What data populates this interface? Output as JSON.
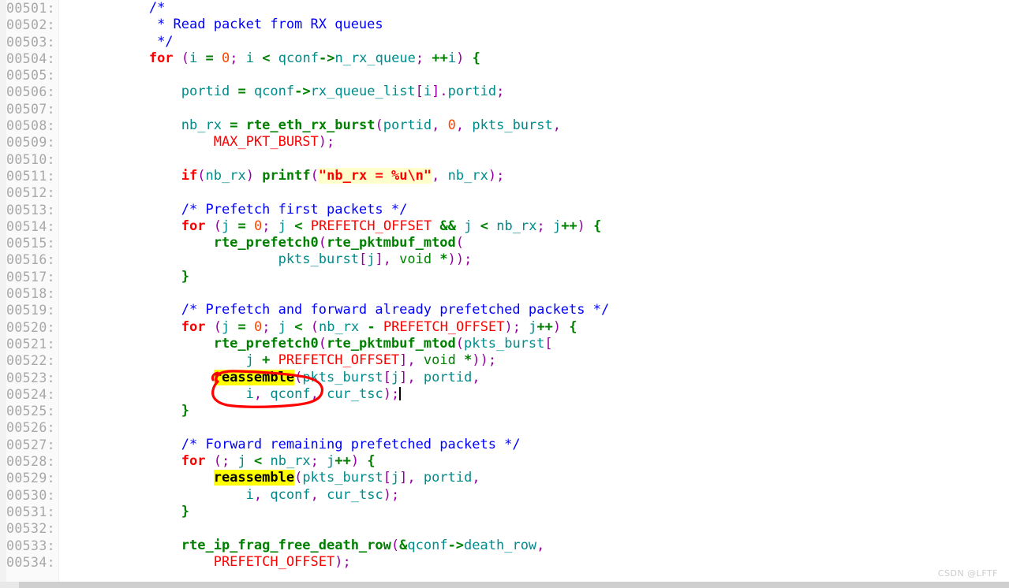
{
  "editor": {
    "language": "c",
    "highlight_term": "reassemble",
    "search_string_highlight": "\"nb_rx = %u\\n\"",
    "first_line_number": "00501",
    "last_line_number": "00534",
    "caret_line": "00524",
    "colors": {
      "background": "#ffffff",
      "gutter": "#fafafa",
      "line_number": "#a8a8a8",
      "comment": "#0000ff",
      "keyword": "#ff0000",
      "punctuation": "#9400a0",
      "identifier": "#008b8b",
      "function": "#008000",
      "macro": "#ff0000",
      "number": "#ff4500",
      "string": "#ff0000",
      "string_bg": "#ffffcc",
      "match_highlight_bg": "#ffff00",
      "annotation": "#ff0000",
      "scrollbar": "#cfcfcf"
    }
  },
  "lines": [
    {
      "no": "00501:",
      "tokens": [
        {
          "t": "plain",
          "v": "            "
        },
        {
          "t": "cm",
          "v": "/*"
        }
      ]
    },
    {
      "no": "00502:",
      "tokens": [
        {
          "t": "plain",
          "v": "             "
        },
        {
          "t": "cm",
          "v": "* Read packet from RX queues"
        }
      ]
    },
    {
      "no": "00503:",
      "tokens": [
        {
          "t": "plain",
          "v": "             "
        },
        {
          "t": "cm",
          "v": "*/"
        }
      ]
    },
    {
      "no": "00504:",
      "tokens": [
        {
          "t": "plain",
          "v": "            "
        },
        {
          "t": "kw",
          "v": "for"
        },
        {
          "t": "plain",
          "v": " "
        },
        {
          "t": "pn",
          "v": "("
        },
        {
          "t": "id",
          "v": "i"
        },
        {
          "t": "plain",
          "v": " "
        },
        {
          "t": "op",
          "v": "="
        },
        {
          "t": "plain",
          "v": " "
        },
        {
          "t": "num",
          "v": "0"
        },
        {
          "t": "pn",
          "v": ";"
        },
        {
          "t": "plain",
          "v": " "
        },
        {
          "t": "id",
          "v": "i"
        },
        {
          "t": "plain",
          "v": " "
        },
        {
          "t": "op",
          "v": "<"
        },
        {
          "t": "plain",
          "v": " "
        },
        {
          "t": "id",
          "v": "qconf"
        },
        {
          "t": "op",
          "v": "->"
        },
        {
          "t": "id",
          "v": "n_rx_queue"
        },
        {
          "t": "pn",
          "v": ";"
        },
        {
          "t": "plain",
          "v": " "
        },
        {
          "t": "op",
          "v": "++"
        },
        {
          "t": "id",
          "v": "i"
        },
        {
          "t": "pn",
          "v": ")"
        },
        {
          "t": "plain",
          "v": " "
        },
        {
          "t": "op",
          "v": "{"
        }
      ]
    },
    {
      "no": "00505:",
      "tokens": []
    },
    {
      "no": "00506:",
      "tokens": [
        {
          "t": "plain",
          "v": "                "
        },
        {
          "t": "id",
          "v": "portid"
        },
        {
          "t": "plain",
          "v": " "
        },
        {
          "t": "op",
          "v": "="
        },
        {
          "t": "plain",
          "v": " "
        },
        {
          "t": "id",
          "v": "qconf"
        },
        {
          "t": "op",
          "v": "->"
        },
        {
          "t": "id",
          "v": "rx_queue_list"
        },
        {
          "t": "pn",
          "v": "["
        },
        {
          "t": "id",
          "v": "i"
        },
        {
          "t": "pn",
          "v": "]"
        },
        {
          "t": "pn",
          "v": "."
        },
        {
          "t": "id",
          "v": "portid"
        },
        {
          "t": "pn",
          "v": ";"
        }
      ]
    },
    {
      "no": "00507:",
      "tokens": []
    },
    {
      "no": "00508:",
      "tokens": [
        {
          "t": "plain",
          "v": "                "
        },
        {
          "t": "id",
          "v": "nb_rx"
        },
        {
          "t": "plain",
          "v": " "
        },
        {
          "t": "op",
          "v": "="
        },
        {
          "t": "plain",
          "v": " "
        },
        {
          "t": "fn",
          "v": "rte_eth_rx_burst"
        },
        {
          "t": "pn",
          "v": "("
        },
        {
          "t": "id",
          "v": "portid"
        },
        {
          "t": "pn",
          "v": ","
        },
        {
          "t": "plain",
          "v": " "
        },
        {
          "t": "num",
          "v": "0"
        },
        {
          "t": "pn",
          "v": ","
        },
        {
          "t": "plain",
          "v": " "
        },
        {
          "t": "id",
          "v": "pkts_burst"
        },
        {
          "t": "pn",
          "v": ","
        }
      ]
    },
    {
      "no": "00509:",
      "tokens": [
        {
          "t": "plain",
          "v": "                    "
        },
        {
          "t": "mac",
          "v": "MAX_PKT_BURST"
        },
        {
          "t": "pn",
          "v": ");"
        }
      ]
    },
    {
      "no": "00510:",
      "tokens": []
    },
    {
      "no": "00511:",
      "tokens": [
        {
          "t": "plain",
          "v": "                "
        },
        {
          "t": "kw",
          "v": "if"
        },
        {
          "t": "pn",
          "v": "("
        },
        {
          "t": "id",
          "v": "nb_rx"
        },
        {
          "t": "pn",
          "v": ")"
        },
        {
          "t": "plain",
          "v": " "
        },
        {
          "t": "fn",
          "v": "printf"
        },
        {
          "t": "pn",
          "v": "("
        },
        {
          "t": "str",
          "v": "\"nb_rx = %u\\n\""
        },
        {
          "t": "pn",
          "v": ","
        },
        {
          "t": "plain",
          "v": " "
        },
        {
          "t": "id",
          "v": "nb_rx"
        },
        {
          "t": "pn",
          "v": ");"
        }
      ]
    },
    {
      "no": "00512:",
      "tokens": []
    },
    {
      "no": "00513:",
      "tokens": [
        {
          "t": "plain",
          "v": "                "
        },
        {
          "t": "cm",
          "v": "/* Prefetch first packets */"
        }
      ]
    },
    {
      "no": "00514:",
      "tokens": [
        {
          "t": "plain",
          "v": "                "
        },
        {
          "t": "kw",
          "v": "for"
        },
        {
          "t": "plain",
          "v": " "
        },
        {
          "t": "pn",
          "v": "("
        },
        {
          "t": "id",
          "v": "j"
        },
        {
          "t": "plain",
          "v": " "
        },
        {
          "t": "op",
          "v": "="
        },
        {
          "t": "plain",
          "v": " "
        },
        {
          "t": "num",
          "v": "0"
        },
        {
          "t": "pn",
          "v": ";"
        },
        {
          "t": "plain",
          "v": " "
        },
        {
          "t": "id",
          "v": "j"
        },
        {
          "t": "plain",
          "v": " "
        },
        {
          "t": "op",
          "v": "<"
        },
        {
          "t": "plain",
          "v": " "
        },
        {
          "t": "mac",
          "v": "PREFETCH_OFFSET"
        },
        {
          "t": "plain",
          "v": " "
        },
        {
          "t": "op",
          "v": "&&"
        },
        {
          "t": "plain",
          "v": " "
        },
        {
          "t": "id",
          "v": "j"
        },
        {
          "t": "plain",
          "v": " "
        },
        {
          "t": "op",
          "v": "<"
        },
        {
          "t": "plain",
          "v": " "
        },
        {
          "t": "id",
          "v": "nb_rx"
        },
        {
          "t": "pn",
          "v": ";"
        },
        {
          "t": "plain",
          "v": " "
        },
        {
          "t": "id",
          "v": "j"
        },
        {
          "t": "op",
          "v": "++"
        },
        {
          "t": "pn",
          "v": ")"
        },
        {
          "t": "plain",
          "v": " "
        },
        {
          "t": "op",
          "v": "{"
        }
      ]
    },
    {
      "no": "00515:",
      "tokens": [
        {
          "t": "plain",
          "v": "                    "
        },
        {
          "t": "fn",
          "v": "rte_prefetch0"
        },
        {
          "t": "pn",
          "v": "("
        },
        {
          "t": "fn",
          "v": "rte_pktmbuf_mtod"
        },
        {
          "t": "pn",
          "v": "("
        }
      ]
    },
    {
      "no": "00516:",
      "tokens": [
        {
          "t": "plain",
          "v": "                            "
        },
        {
          "t": "id",
          "v": "pkts_burst"
        },
        {
          "t": "pn",
          "v": "["
        },
        {
          "t": "id",
          "v": "j"
        },
        {
          "t": "pn",
          "v": "],"
        },
        {
          "t": "plain",
          "v": " "
        },
        {
          "t": "ty",
          "v": "void"
        },
        {
          "t": "plain",
          "v": " "
        },
        {
          "t": "op",
          "v": "*"
        },
        {
          "t": "pn",
          "v": "));"
        }
      ]
    },
    {
      "no": "00517:",
      "tokens": [
        {
          "t": "plain",
          "v": "                "
        },
        {
          "t": "op",
          "v": "}"
        }
      ]
    },
    {
      "no": "00518:",
      "tokens": []
    },
    {
      "no": "00519:",
      "tokens": [
        {
          "t": "plain",
          "v": "                "
        },
        {
          "t": "cm",
          "v": "/* Prefetch and forward already prefetched packets */"
        }
      ]
    },
    {
      "no": "00520:",
      "tokens": [
        {
          "t": "plain",
          "v": "                "
        },
        {
          "t": "kw",
          "v": "for"
        },
        {
          "t": "plain",
          "v": " "
        },
        {
          "t": "pn",
          "v": "("
        },
        {
          "t": "id",
          "v": "j"
        },
        {
          "t": "plain",
          "v": " "
        },
        {
          "t": "op",
          "v": "="
        },
        {
          "t": "plain",
          "v": " "
        },
        {
          "t": "num",
          "v": "0"
        },
        {
          "t": "pn",
          "v": ";"
        },
        {
          "t": "plain",
          "v": " "
        },
        {
          "t": "id",
          "v": "j"
        },
        {
          "t": "plain",
          "v": " "
        },
        {
          "t": "op",
          "v": "<"
        },
        {
          "t": "plain",
          "v": " "
        },
        {
          "t": "pn",
          "v": "("
        },
        {
          "t": "id",
          "v": "nb_rx"
        },
        {
          "t": "plain",
          "v": " "
        },
        {
          "t": "op",
          "v": "-"
        },
        {
          "t": "plain",
          "v": " "
        },
        {
          "t": "mac",
          "v": "PREFETCH_OFFSET"
        },
        {
          "t": "pn",
          "v": ");"
        },
        {
          "t": "plain",
          "v": " "
        },
        {
          "t": "id",
          "v": "j"
        },
        {
          "t": "op",
          "v": "++"
        },
        {
          "t": "pn",
          "v": ")"
        },
        {
          "t": "plain",
          "v": " "
        },
        {
          "t": "op",
          "v": "{"
        }
      ]
    },
    {
      "no": "00521:",
      "tokens": [
        {
          "t": "plain",
          "v": "                    "
        },
        {
          "t": "fn",
          "v": "rte_prefetch0"
        },
        {
          "t": "pn",
          "v": "("
        },
        {
          "t": "fn",
          "v": "rte_pktmbuf_mtod"
        },
        {
          "t": "pn",
          "v": "("
        },
        {
          "t": "id",
          "v": "pkts_burst"
        },
        {
          "t": "pn",
          "v": "["
        }
      ]
    },
    {
      "no": "00522:",
      "tokens": [
        {
          "t": "plain",
          "v": "                        "
        },
        {
          "t": "id",
          "v": "j"
        },
        {
          "t": "plain",
          "v": " "
        },
        {
          "t": "op",
          "v": "+"
        },
        {
          "t": "plain",
          "v": " "
        },
        {
          "t": "mac",
          "v": "PREFETCH_OFFSET"
        },
        {
          "t": "pn",
          "v": "],"
        },
        {
          "t": "plain",
          "v": " "
        },
        {
          "t": "ty",
          "v": "void"
        },
        {
          "t": "plain",
          "v": " "
        },
        {
          "t": "op",
          "v": "*"
        },
        {
          "t": "pn",
          "v": "));"
        }
      ]
    },
    {
      "no": "00523:",
      "tokens": [
        {
          "t": "plain",
          "v": "                    "
        },
        {
          "t": "hl",
          "v": "reassemble"
        },
        {
          "t": "pn",
          "v": "("
        },
        {
          "t": "id",
          "v": "pkts_burst"
        },
        {
          "t": "pn",
          "v": "["
        },
        {
          "t": "id",
          "v": "j"
        },
        {
          "t": "pn",
          "v": "],"
        },
        {
          "t": "plain",
          "v": " "
        },
        {
          "t": "id",
          "v": "portid"
        },
        {
          "t": "pn",
          "v": ","
        }
      ]
    },
    {
      "no": "00524:",
      "tokens": [
        {
          "t": "plain",
          "v": "                        "
        },
        {
          "t": "id",
          "v": "i"
        },
        {
          "t": "pn",
          "v": ","
        },
        {
          "t": "plain",
          "v": " "
        },
        {
          "t": "id",
          "v": "qconf"
        },
        {
          "t": "pn",
          "v": ","
        },
        {
          "t": "plain",
          "v": " "
        },
        {
          "t": "id",
          "v": "cur_tsc"
        },
        {
          "t": "pn",
          "v": ");"
        },
        {
          "t": "caret",
          "v": ""
        }
      ]
    },
    {
      "no": "00525:",
      "tokens": [
        {
          "t": "plain",
          "v": "                "
        },
        {
          "t": "op",
          "v": "}"
        }
      ]
    },
    {
      "no": "00526:",
      "tokens": []
    },
    {
      "no": "00527:",
      "tokens": [
        {
          "t": "plain",
          "v": "                "
        },
        {
          "t": "cm",
          "v": "/* Forward remaining prefetched packets */"
        }
      ]
    },
    {
      "no": "00528:",
      "tokens": [
        {
          "t": "plain",
          "v": "                "
        },
        {
          "t": "kw",
          "v": "for"
        },
        {
          "t": "plain",
          "v": " "
        },
        {
          "t": "pn",
          "v": "(;"
        },
        {
          "t": "plain",
          "v": " "
        },
        {
          "t": "id",
          "v": "j"
        },
        {
          "t": "plain",
          "v": " "
        },
        {
          "t": "op",
          "v": "<"
        },
        {
          "t": "plain",
          "v": " "
        },
        {
          "t": "id",
          "v": "nb_rx"
        },
        {
          "t": "pn",
          "v": ";"
        },
        {
          "t": "plain",
          "v": " "
        },
        {
          "t": "id",
          "v": "j"
        },
        {
          "t": "op",
          "v": "++"
        },
        {
          "t": "pn",
          "v": ")"
        },
        {
          "t": "plain",
          "v": " "
        },
        {
          "t": "op",
          "v": "{"
        }
      ]
    },
    {
      "no": "00529:",
      "tokens": [
        {
          "t": "plain",
          "v": "                    "
        },
        {
          "t": "hl",
          "v": "reassemble"
        },
        {
          "t": "pn",
          "v": "("
        },
        {
          "t": "id",
          "v": "pkts_burst"
        },
        {
          "t": "pn",
          "v": "["
        },
        {
          "t": "id",
          "v": "j"
        },
        {
          "t": "pn",
          "v": "],"
        },
        {
          "t": "plain",
          "v": " "
        },
        {
          "t": "id",
          "v": "portid"
        },
        {
          "t": "pn",
          "v": ","
        }
      ]
    },
    {
      "no": "00530:",
      "tokens": [
        {
          "t": "plain",
          "v": "                        "
        },
        {
          "t": "id",
          "v": "i"
        },
        {
          "t": "pn",
          "v": ","
        },
        {
          "t": "plain",
          "v": " "
        },
        {
          "t": "id",
          "v": "qconf"
        },
        {
          "t": "pn",
          "v": ","
        },
        {
          "t": "plain",
          "v": " "
        },
        {
          "t": "id",
          "v": "cur_tsc"
        },
        {
          "t": "pn",
          "v": ");"
        }
      ]
    },
    {
      "no": "00531:",
      "tokens": [
        {
          "t": "plain",
          "v": "                "
        },
        {
          "t": "op",
          "v": "}"
        }
      ]
    },
    {
      "no": "00532:",
      "tokens": []
    },
    {
      "no": "00533:",
      "tokens": [
        {
          "t": "plain",
          "v": "                "
        },
        {
          "t": "fn",
          "v": "rte_ip_frag_free_death_row"
        },
        {
          "t": "pn",
          "v": "("
        },
        {
          "t": "op",
          "v": "&"
        },
        {
          "t": "id",
          "v": "qconf"
        },
        {
          "t": "op",
          "v": "->"
        },
        {
          "t": "id",
          "v": "death_row"
        },
        {
          "t": "pn",
          "v": ","
        }
      ]
    },
    {
      "no": "00534:",
      "tokens": [
        {
          "t": "plain",
          "v": "                    "
        },
        {
          "t": "mac",
          "v": "PREFETCH_OFFSET"
        },
        {
          "t": "pn",
          "v": ");"
        }
      ]
    }
  ],
  "annotation": {
    "shape": "hand-drawn-ellipse",
    "target": "reassemble",
    "color": "#ff0000"
  },
  "watermark": {
    "text": "CSDN @LFTF"
  }
}
